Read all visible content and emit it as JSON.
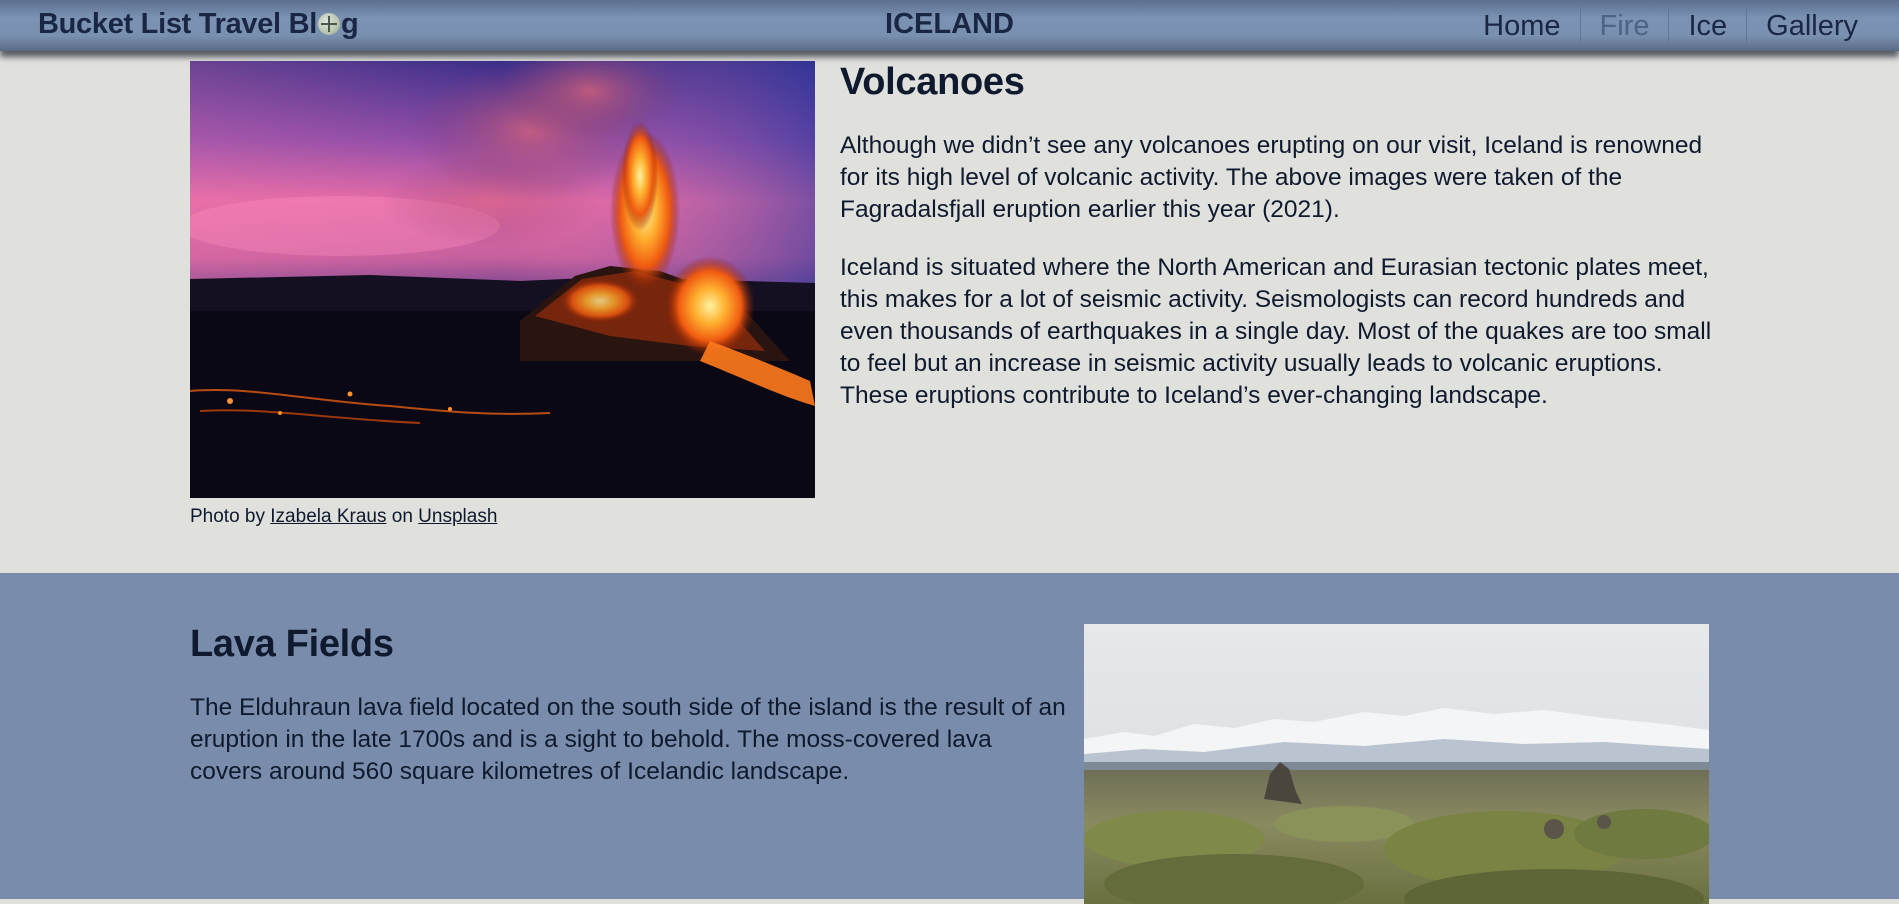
{
  "header": {
    "brand_prefix": "Bucket List Travel Bl",
    "brand_suffix": "g",
    "page_title": "ICELAND",
    "nav": [
      {
        "label": "Home",
        "active": false
      },
      {
        "label": "Fire",
        "active": true
      },
      {
        "label": "Ice",
        "active": false
      },
      {
        "label": "Gallery",
        "active": false
      }
    ],
    "brand_icon": "globe-compass-icon"
  },
  "volcanoes": {
    "heading": "Volcanoes",
    "paragraph1": "Although we didn’t see any volcanoes erupting on our visit, Iceland is renowned for its high level of volcanic activity. The above images were taken of the Fagradalsfjall eruption earlier this year (2021).",
    "paragraph2": "Iceland is situated where the North American and Eurasian tectonic plates meet, this makes for a lot of seismic activity. Seismologists can record hundreds and even thousands of earthquakes in a single day. Most of the quakes are too small to feel but an increase in seismic activity usually leads to volcanic eruptions. These eruptions contribute to Iceland’s ever-changing landscape.",
    "caption": {
      "prefix": "Photo by ",
      "author": "Izabela Kraus",
      "middle": " on ",
      "source": "Unsplash"
    }
  },
  "lava_fields": {
    "heading": "Lava Fields",
    "paragraph": "The Elduhraun lava field located on the south side of the island is the result of an eruption in the late 1700s and is a sight to behold. The moss-covered lava covers around 560 square kilometres of Icelandic landscape."
  },
  "colors": {
    "header_bg": "#7a90b0",
    "text": "#1a2744",
    "nav_active": "#4f6384",
    "section1_bg": "#e0e0dd",
    "section2_bg": "#7a8cab"
  }
}
